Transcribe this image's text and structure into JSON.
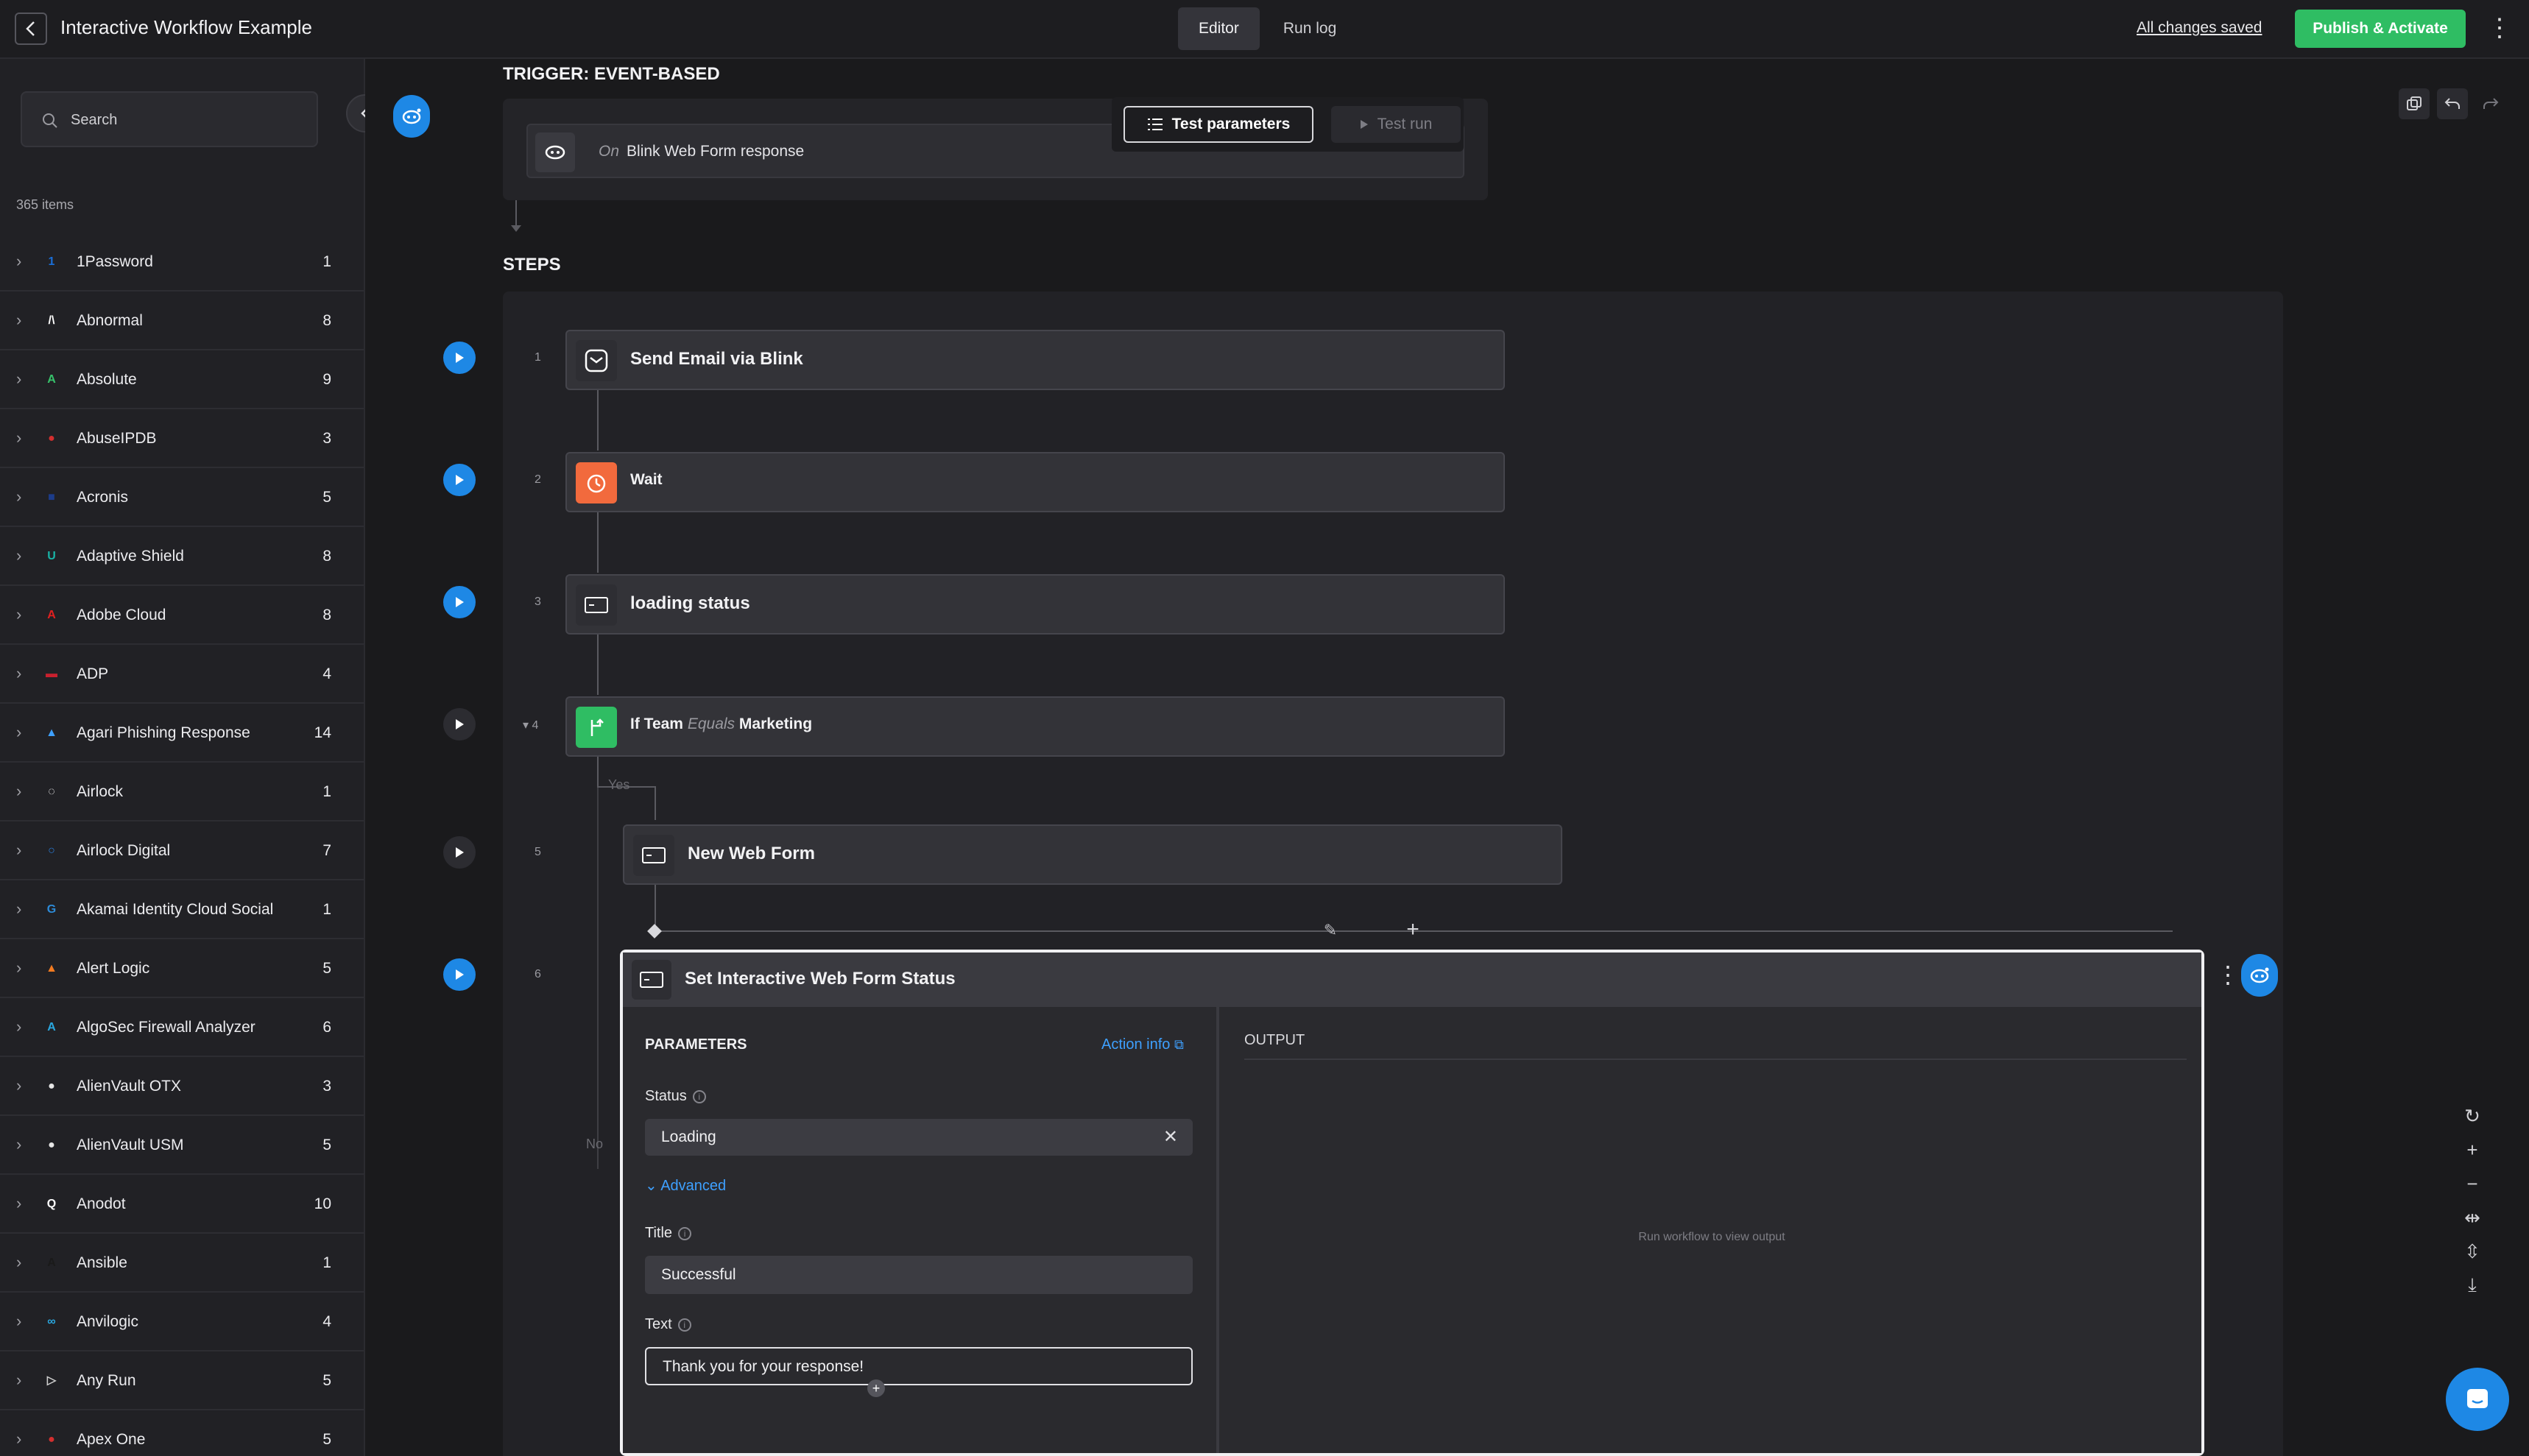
{
  "header": {
    "title": "Interactive Workflow Example",
    "tabs": [
      "Editor",
      "Run log"
    ],
    "saved_status": "All changes saved",
    "publish_label": "Publish & Activate"
  },
  "sidebar": {
    "search_placeholder": "Search",
    "item_count": "365 items",
    "items": [
      {
        "name": "1Password",
        "count": "1",
        "color": "#1a6fd8",
        "glyph": "1"
      },
      {
        "name": "Abnormal",
        "count": "8",
        "color": "#ffffff",
        "glyph": "/\\"
      },
      {
        "name": "Absolute",
        "count": "9",
        "color": "#37c26b",
        "glyph": "A"
      },
      {
        "name": "AbuseIPDB",
        "count": "3",
        "color": "#d32f2f",
        "glyph": "●"
      },
      {
        "name": "Acronis",
        "count": "5",
        "color": "#1c3c8a",
        "glyph": "■"
      },
      {
        "name": "Adaptive Shield",
        "count": "8",
        "color": "#19b3a6",
        "glyph": "U"
      },
      {
        "name": "Adobe Cloud",
        "count": "8",
        "color": "#e02020",
        "glyph": "A"
      },
      {
        "name": "ADP",
        "count": "4",
        "color": "#c8202e",
        "glyph": "▬"
      },
      {
        "name": "Agari Phishing Response",
        "count": "14",
        "color": "#3ea0ff",
        "glyph": "▲"
      },
      {
        "name": "Airlock",
        "count": "1",
        "color": "#ffffff",
        "glyph": "◌"
      },
      {
        "name": "Airlock Digital",
        "count": "7",
        "color": "#2a7bd6",
        "glyph": "○"
      },
      {
        "name": "Akamai Identity Cloud Social",
        "count": "1",
        "color": "#2d8bd8",
        "glyph": "G"
      },
      {
        "name": "Alert Logic",
        "count": "5",
        "color": "#f27b21",
        "glyph": "▲"
      },
      {
        "name": "AlgoSec Firewall Analyzer",
        "count": "6",
        "color": "#2aa8e0",
        "glyph": "A"
      },
      {
        "name": "AlienVault OTX",
        "count": "3",
        "color": "#e6e6e6",
        "glyph": "●"
      },
      {
        "name": "AlienVault USM",
        "count": "5",
        "color": "#e6e6e6",
        "glyph": "●"
      },
      {
        "name": "Anodot",
        "count": "10",
        "color": "#ffffff",
        "glyph": "Q"
      },
      {
        "name": "Ansible",
        "count": "1",
        "color": "#1a1a1a",
        "glyph": "A"
      },
      {
        "name": "Anvilogic",
        "count": "4",
        "color": "#2aa8e0",
        "glyph": "∞"
      },
      {
        "name": "Any Run",
        "count": "5",
        "color": "#cfcfcf",
        "glyph": "▷"
      },
      {
        "name": "Apex One",
        "count": "5",
        "color": "#d32f2f",
        "glyph": "●"
      }
    ]
  },
  "trigger": {
    "section_label": "TRIGGER: EVENT-BASED",
    "on_word": "On",
    "event": "Blink Web Form response",
    "test_params_label": "Test parameters",
    "test_run_label": "Test run"
  },
  "steps": {
    "section_label": "STEPS",
    "items": [
      {
        "num": "1",
        "title": "Send Email via Blink"
      },
      {
        "num": "2",
        "title": "Wait"
      },
      {
        "num": "3",
        "title": "loading status"
      },
      {
        "num": "4",
        "cond_if": "If",
        "cond_field": "Team",
        "cond_op": "Equals",
        "cond_value": "Marketing"
      },
      {
        "num": "5",
        "title": "New Web Form"
      },
      {
        "num": "6",
        "title": "Set Interactive Web Form Status"
      }
    ],
    "branch_yes": "Yes",
    "branch_no": "No"
  },
  "step6": {
    "params_title": "PARAMETERS",
    "action_info": "Action info",
    "status_label": "Status",
    "status_value": "Loading",
    "advanced_label": "Advanced",
    "title_label": "Title",
    "title_value": "Successful",
    "text_label": "Text",
    "text_value": "Thank you for your response!",
    "output_title": "OUTPUT",
    "output_empty": "Run workflow to view output"
  },
  "colors": {
    "accent_blue": "#1e88e5",
    "publish_green": "#2fbd63",
    "wait_orange": "#f26a3d",
    "condition_green": "#2fbd63"
  }
}
